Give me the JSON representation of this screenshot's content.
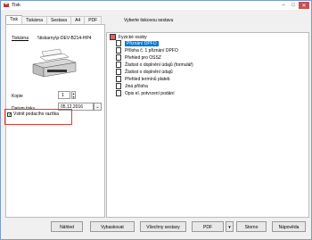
{
  "window": {
    "title": "Tisk"
  },
  "tabs": [
    "Tisk",
    "Tiskárna",
    "Sestava",
    "A4",
    "PDF"
  ],
  "sestav_header": "Vyberte tiskovou sestavu",
  "printer": {
    "label": "Tiskárna",
    "value": "\\\\tiskarny\\p-DEV-B214-HP4"
  },
  "kopie": {
    "label": "Kopie",
    "value": "1"
  },
  "datum": {
    "label": "Datum tisku",
    "value": "05.12.2016"
  },
  "checkbox": {
    "label": "Vstnit podacího razítka",
    "checked": true
  },
  "tree": {
    "root": "Fyzické osoby",
    "items": [
      "Přiznání DPFO",
      "Příloha č. 1 přiznání DPFO",
      "Přehled pro OSSZ",
      "Žádost o doplnění údajů (formulář)",
      "Žádost o doplnění údajů",
      "Přehled termínů plateb",
      "Jiná příloha",
      "Opis el. potvrzení podání"
    ],
    "selected_index": 0
  },
  "buttons": {
    "nahled": "Náhled",
    "vybaskovat": "Vybaskovat",
    "vsechny": "Všechny sestavy",
    "pdf": "PDF",
    "storno": "Storno",
    "napoveda": "Nápověda"
  }
}
